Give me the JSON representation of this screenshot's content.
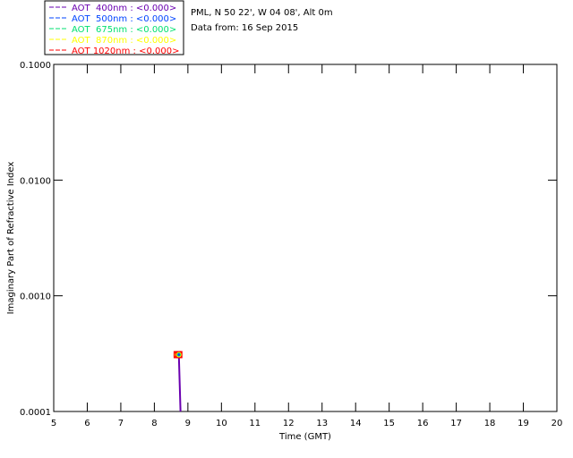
{
  "header": {
    "site": "PML, N 50 22', W 04 08', Alt 0m",
    "date": "Data from: 16 Sep 2015"
  },
  "chart_data": {
    "type": "line",
    "title": "",
    "xlabel": "Time (GMT)",
    "ylabel": "Imaginary Part of Refractive Index",
    "xlim": [
      5,
      20
    ],
    "ylim": [
      0.0001,
      0.1
    ],
    "yscale": "log",
    "xticks": [
      "5",
      "6",
      "7",
      "8",
      "9",
      "10",
      "11",
      "12",
      "13",
      "14",
      "15",
      "16",
      "17",
      "18",
      "19",
      "20"
    ],
    "yticks": [
      "0.0001",
      "0.0010",
      "0.0100",
      "0.1000"
    ],
    "grid": false,
    "legend_position": "top-left-outside",
    "series": [
      {
        "name": "AOT  400nm : <0.000>",
        "color": "#6a00b0",
        "x": [
          8.68,
          8.73,
          8.78
        ],
        "y": [
          0.00031,
          0.00031,
          0.0001
        ]
      },
      {
        "name": "AOT  500nm : <0.000>",
        "color": "#0044ff",
        "x": [
          8.68,
          8.73
        ],
        "y": [
          0.00031,
          0.00031
        ]
      },
      {
        "name": "AOT  675nm : <0.000>",
        "color": "#00e070",
        "x": [
          8.68,
          8.73
        ],
        "y": [
          0.00031,
          0.00031
        ]
      },
      {
        "name": "AOT  870nm : <0.000>",
        "color": "#ffff00",
        "x": [
          8.68,
          8.73
        ],
        "y": [
          0.00031,
          0.00031
        ]
      },
      {
        "name": "AOT 1020nm : <0.000>",
        "color": "#ff0000",
        "x": [
          8.68,
          8.73
        ],
        "y": [
          0.00031,
          0.00031
        ]
      }
    ]
  }
}
